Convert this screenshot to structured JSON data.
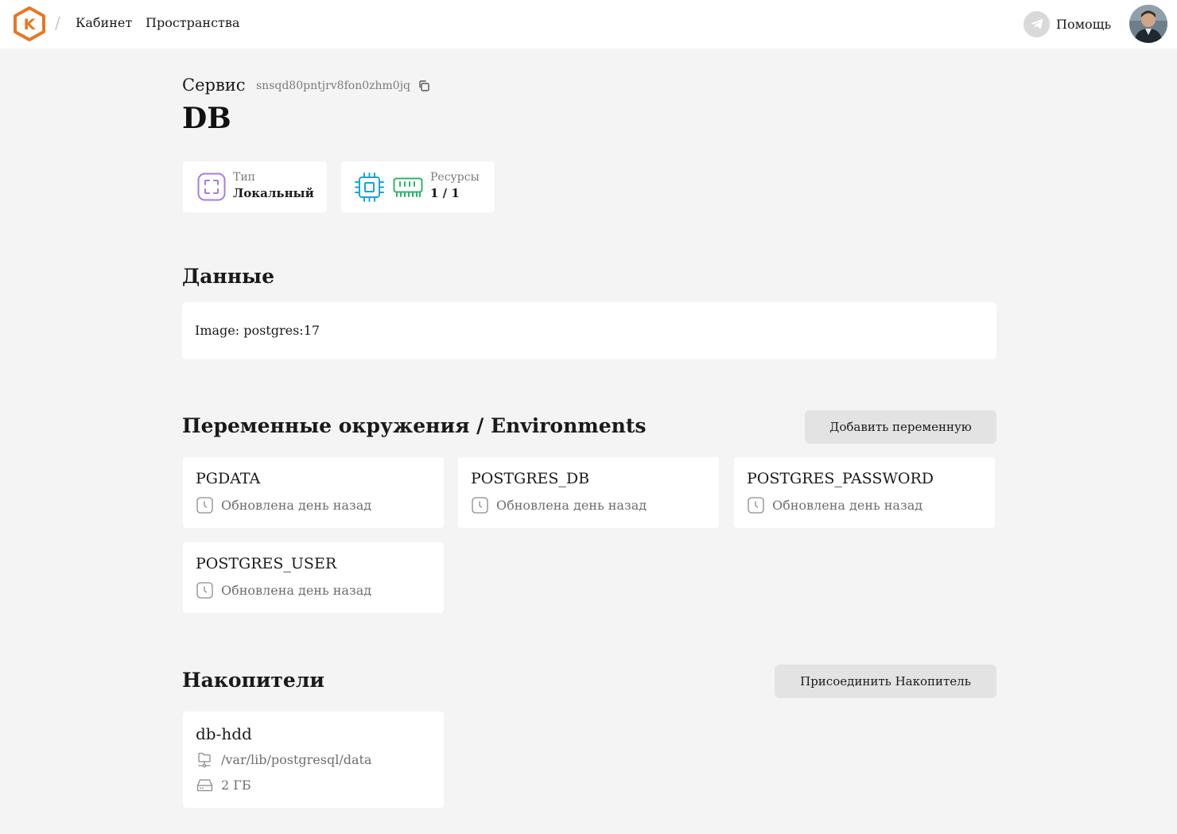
{
  "header": {
    "breadcrumbs": [
      "Кабинет",
      "Пространства"
    ],
    "separator": "/",
    "logo_letter": "K",
    "help_label": "Помощь",
    "brand_color": "#e87722"
  },
  "service": {
    "label": "Сервис",
    "id": "snsqd80pntjrv8fon0zhm0jq",
    "title": "DB"
  },
  "info_cards": {
    "type": {
      "label": "Тип",
      "value": "Локальный",
      "icon": "local-frame-icon",
      "color": "#a27de6"
    },
    "resources": {
      "label": "Ресурсы",
      "value": "1 / 1",
      "cpu_icon": "cpu-icon",
      "ram_icon": "ram-icon",
      "cpu_color": "#1aa3d9",
      "ram_color": "#2db36b"
    }
  },
  "data_section": {
    "title": "Данные",
    "image_text": "Image: postgres:17"
  },
  "env_section": {
    "title": "Переменные окружения / Environments",
    "add_button": "Добавить переменную",
    "variables": [
      {
        "name": "PGDATA",
        "updated": "Обновлена день назад"
      },
      {
        "name": "POSTGRES_DB",
        "updated": "Обновлена день назад"
      },
      {
        "name": "POSTGRES_PASSWORD",
        "updated": "Обновлена день назад"
      },
      {
        "name": "POSTGRES_USER",
        "updated": "Обновлена день назад"
      }
    ]
  },
  "volumes_section": {
    "title": "Накопители",
    "attach_button": "Присоединить Накопитель",
    "volumes": [
      {
        "name": "db-hdd",
        "path": "/var/lib/postgresql/data",
        "size": "2 ГБ"
      }
    ]
  }
}
